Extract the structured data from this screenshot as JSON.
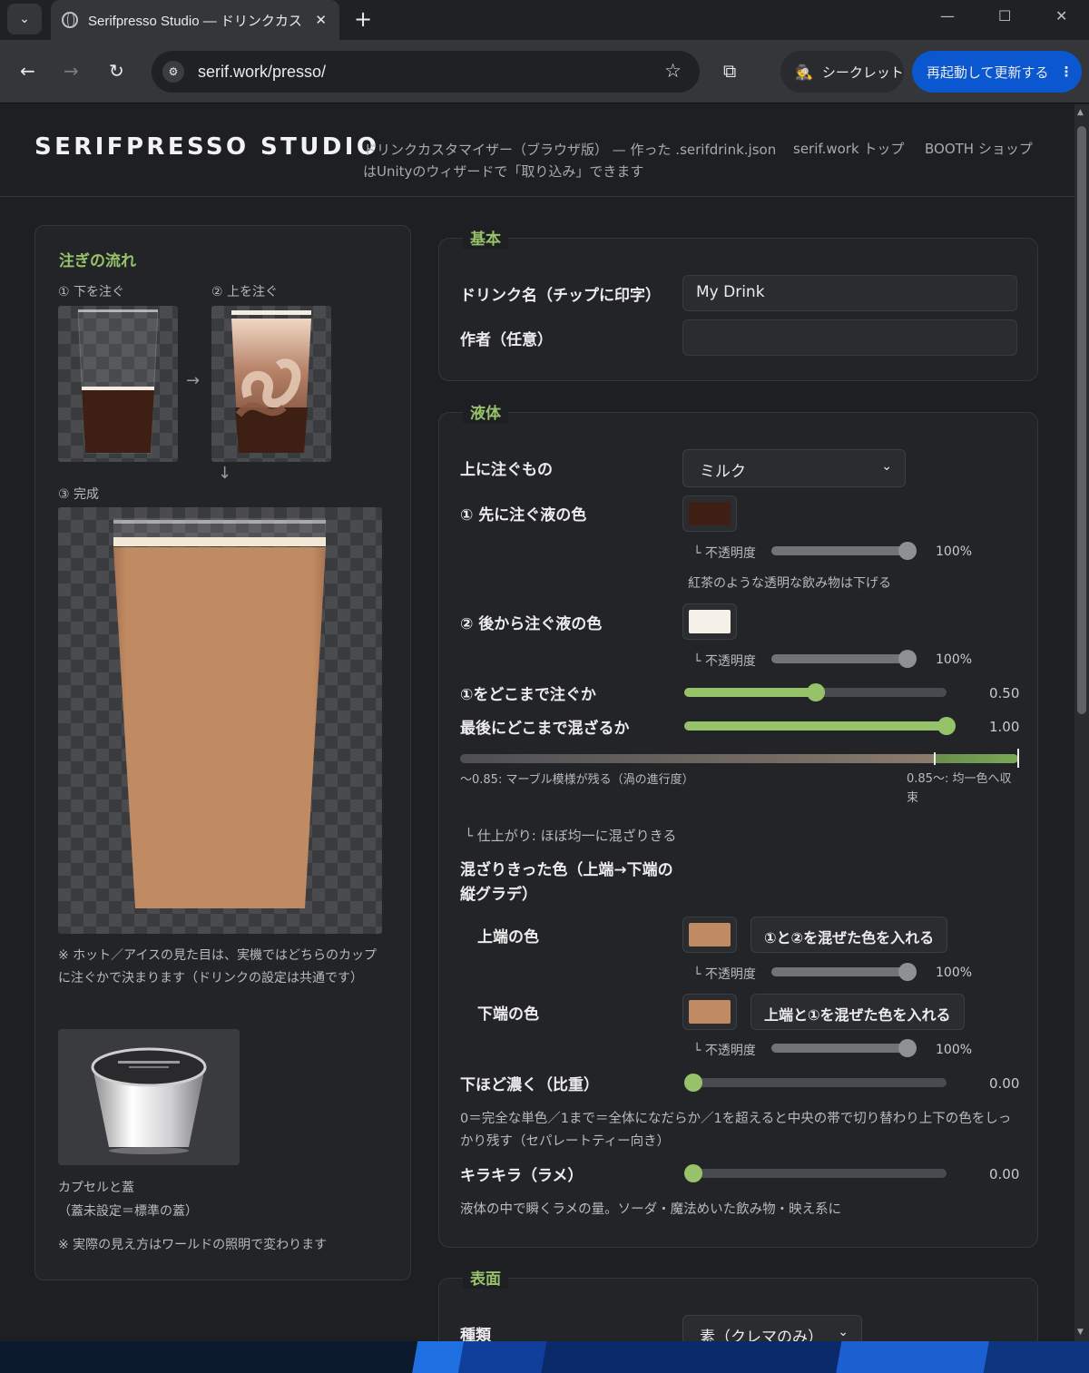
{
  "browser": {
    "tab_title": "Serifpresso Studio — ドリンクカス",
    "url": "serif.work/presso/",
    "incognito_label": "シークレット",
    "restart_label": "再起動して更新する"
  },
  "header": {
    "logo": "SERIFPRESSO STUDIO",
    "tagline": "ドリンクカスタマイザー（ブラウザ版） — 作った .serifdrink.json はUnityのウィザードで「取り込み」できます",
    "nav": [
      "serif.work トップ",
      "BOOTH ショップ"
    ]
  },
  "preview": {
    "title": "注ぎの流れ",
    "step1": "① 下を注ぐ",
    "step2": "② 上を注ぐ",
    "step3": "③ 完成",
    "arrow_right": "→",
    "arrow_down": "↓",
    "note1": "※ ホット／アイスの見た目は、実機ではどちらのカップに注ぐかで決まります（ドリンクの設定は共通です）",
    "capsule_label": "カプセルと蓋",
    "capsule_sub": "（蓋未設定＝標準の蓋）",
    "note2": "※ 実際の見え方はワールドの照明で変わります"
  },
  "basic": {
    "legend": "基本",
    "name_label": "ドリンク名（チップに印字）",
    "name_value": "My Drink",
    "author_label": "作者（任意）",
    "author_value": ""
  },
  "liquid": {
    "legend": "液体",
    "top_pour_label": "上に注ぐもの",
    "top_pour_value": "ミルク",
    "color1_label": "① 先に注ぐ液の色",
    "color1": "#3d1f14",
    "opacity_label": "└ 不透明度",
    "opacity1": 1.0,
    "opacity1_text": "100%",
    "color1_hint": "紅茶のような透明な飲み物は下げる",
    "color2_label": "② 後から注ぐ液の色",
    "color2": "#f6f1e8",
    "opacity2": 1.0,
    "opacity2_text": "100%",
    "pour_level_label": "①をどこまで注ぐか",
    "pour_level": 0.5,
    "pour_level_text": "0.50",
    "mix_label": "最後にどこまで混ざるか",
    "mix": 1.0,
    "mix_text": "1.00",
    "mix_scale_left": "〜0.85: マーブル模様が残る（渦の進行度）",
    "mix_scale_right": "0.85〜: 均一色へ収束",
    "finish_text": "└ 仕上がり: ほぼ均一に混ざりきる",
    "gradient_label": "混ざりきった色（上端→下端の縦グラデ）",
    "top_color_label": "上端の色",
    "top_color": "#c08a62",
    "top_color_btn": "①と②を混ぜた色を入れる",
    "opacity3": 1.0,
    "opacity3_text": "100%",
    "bottom_color_label": "下端の色",
    "bottom_color": "#c08a62",
    "bottom_color_btn": "上端と①を混ぜた色を入れる",
    "opacity4": 1.0,
    "opacity4_text": "100%",
    "density_label": "下ほど濃く（比重）",
    "density": 0.0,
    "density_text": "0.00",
    "density_help": "0＝完全な単色／1まで＝全体になだらか／1を超えると中央の帯で切り替わり上下の色をしっかり残す（セパレートティー向き）",
    "glitter_label": "キラキラ（ラメ）",
    "glitter": 0.0,
    "glitter_text": "0.00",
    "glitter_help": "液体の中で瞬くラメの量。ソーダ・魔法めいた飲み物・映え系に"
  },
  "surface": {
    "legend": "表面",
    "type_label": "種類",
    "type_value": "素（クレマのみ）"
  },
  "colors": {
    "accent": "#96c26a",
    "dark_liquid": "#3d1f14",
    "mixed": "#c08a62"
  }
}
